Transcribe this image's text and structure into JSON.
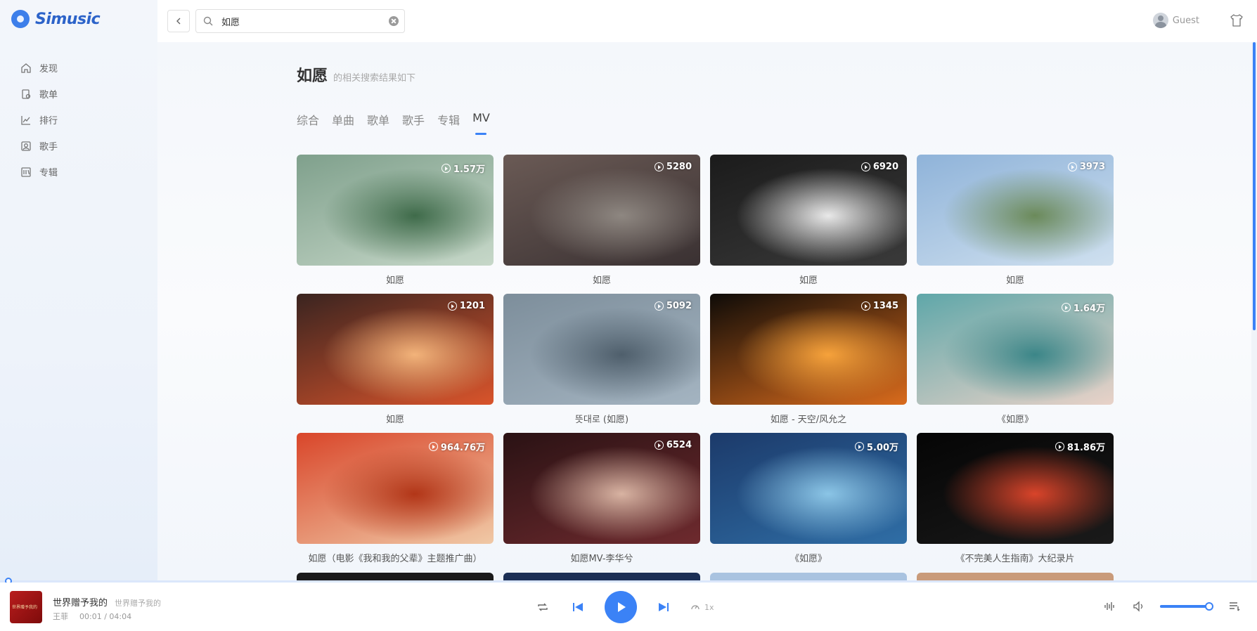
{
  "app": {
    "name": "Simusic"
  },
  "sidebar": {
    "items": [
      {
        "label": "发现",
        "icon": "home-icon"
      },
      {
        "label": "歌单",
        "icon": "playlist-icon"
      },
      {
        "label": "排行",
        "icon": "chart-icon"
      },
      {
        "label": "歌手",
        "icon": "singer-icon"
      },
      {
        "label": "专辑",
        "icon": "album-icon"
      }
    ]
  },
  "topbar": {
    "search_value": "如愿",
    "user_name": "Guest"
  },
  "results": {
    "keyword": "如愿",
    "suffix": "的相关搜索结果如下",
    "tabs": [
      {
        "label": "综合"
      },
      {
        "label": "单曲"
      },
      {
        "label": "歌单"
      },
      {
        "label": "歌手"
      },
      {
        "label": "专辑"
      },
      {
        "label": "MV",
        "active": true
      }
    ],
    "mvs": [
      {
        "title": "如愿",
        "count": "1.57万",
        "bg": [
          "#7fa08c",
          "#c7d8c9",
          "#3f6b4a"
        ]
      },
      {
        "title": "如愿",
        "count": "5280",
        "bg": [
          "#6a5a55",
          "#3a3132",
          "#8e8781"
        ]
      },
      {
        "title": "如愿",
        "count": "6920",
        "bg": [
          "#1b1b1b",
          "#3a3a3a",
          "#e9e9e9"
        ]
      },
      {
        "title": "如愿",
        "count": "3973",
        "bg": [
          "#8fb3d9",
          "#cfe0ef",
          "#6b8a5a"
        ]
      },
      {
        "title": "如愿",
        "count": "1201",
        "bg": [
          "#3a2420",
          "#d9542b",
          "#f2b37a"
        ]
      },
      {
        "title": "뜻대로 (如愿)",
        "count": "5092",
        "bg": [
          "#7d8e9b",
          "#a4b4c1",
          "#4f5f6c"
        ]
      },
      {
        "title": "如愿 - 天空/风允之",
        "count": "1345",
        "bg": [
          "#0e0b08",
          "#d96b1c",
          "#f6a23b"
        ]
      },
      {
        "title": "《如愿》",
        "count": "1.64万",
        "bg": [
          "#5fa7a9",
          "#e9d2c8",
          "#3b8688"
        ]
      },
      {
        "title": "如愿（电影《我和我的父辈》主题推广曲）",
        "count": "964.76万",
        "bg": [
          "#d9462a",
          "#f0c9a6",
          "#b23618"
        ]
      },
      {
        "title": "如愿MV-李华兮",
        "count": "6524",
        "bg": [
          "#2a1214",
          "#6e2a2e",
          "#d8b3a2"
        ]
      },
      {
        "title": "《如愿》",
        "count": "5.00万",
        "bg": [
          "#1c3a6a",
          "#2f6ea6",
          "#8bc5e6"
        ]
      },
      {
        "title": "《不完美人生指南》大纪录片",
        "count": "81.86万",
        "bg": [
          "#050505",
          "#1a1a1a",
          "#d9442a"
        ]
      }
    ],
    "partial_row_colors": [
      "#1a1a1a",
      "#1c2f55",
      "#a9c3e0",
      "#c99b7a"
    ]
  },
  "player": {
    "song": "世界赠予我的",
    "alias": "世界赠予我的",
    "artist": "王菲",
    "time": "00:01 / 04:04",
    "speed": "1x",
    "progress": 0.004,
    "volume": 0.92,
    "cover_text": "世界赠予我的"
  }
}
